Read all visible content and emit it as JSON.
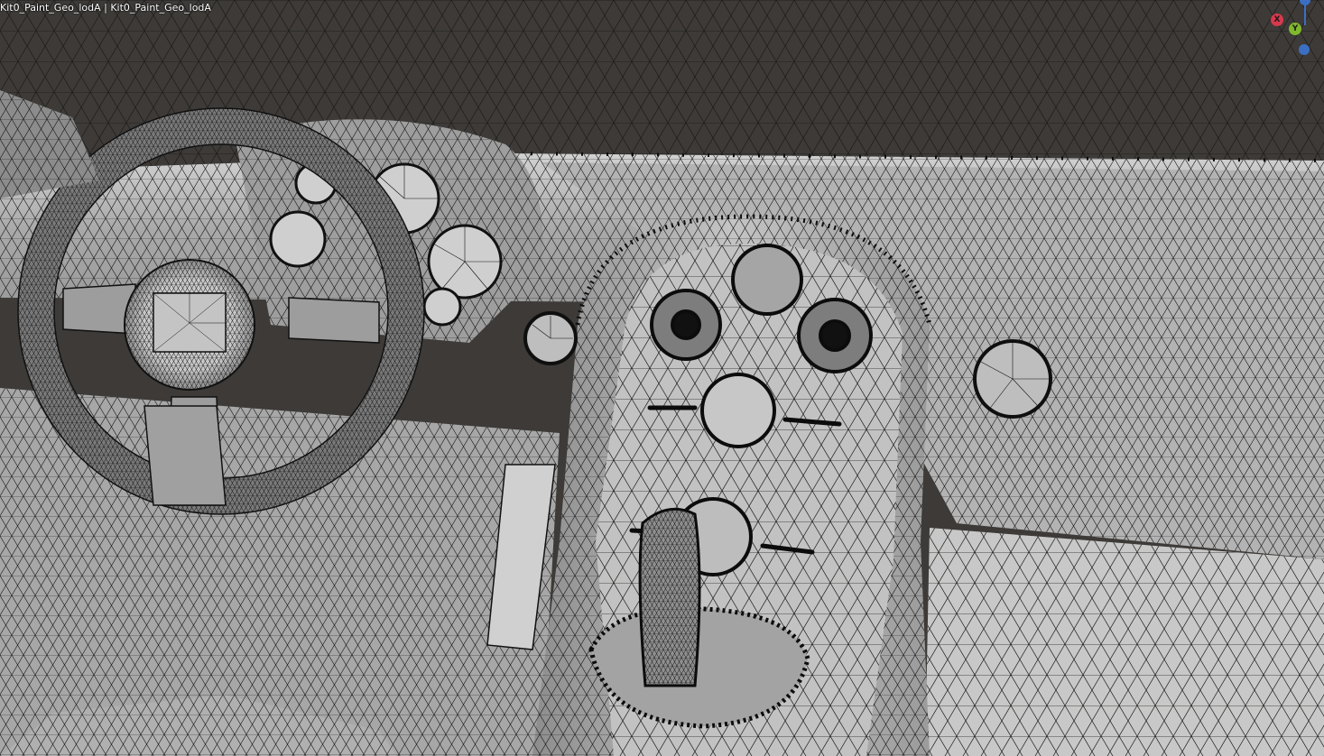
{
  "viewport": {
    "object_label": "Kit0_Paint_Geo_lodA | Kit0_Paint_Geo_lodA",
    "background_color": "#3d3a37",
    "mesh_fill_color": "#b9b9b9",
    "wire_color": "#141414"
  },
  "gizmo": {
    "x_label": "X",
    "y_label": "Y",
    "x_color": "#d6394d",
    "y_color": "#7fb82c",
    "z_color": "#3b6fc4"
  }
}
